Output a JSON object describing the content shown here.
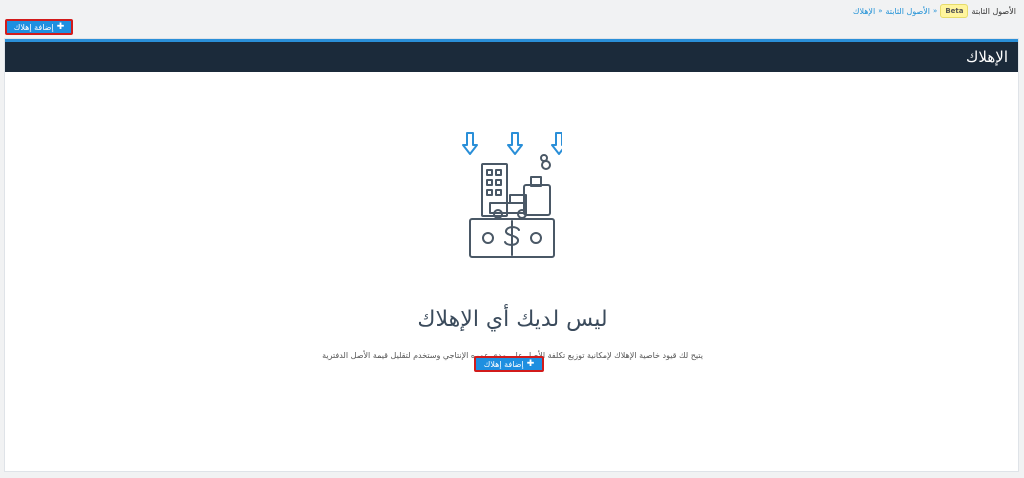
{
  "breadcrumb": {
    "root": "الأصول الثابتة",
    "badge": "Beta",
    "items": [
      "الأصول الثابتة",
      "الإهلاك"
    ]
  },
  "toolbar": {
    "add_label": "إضافة إهلاك"
  },
  "panel": {
    "title": "الإهلاك"
  },
  "empty_state": {
    "title": "ليس لديك أي الإهلاك",
    "description": "يتيح لك قيود خاصية الإهلاك لإمكانية توزيع تكلفة الأصل على مدى عمره الإنتاجي وستخدم لتقليل قيمة الأصل الدفترية",
    "button_label": "إضافة إهلاك"
  },
  "colors": {
    "header_bg": "#1b2a3a",
    "accent": "#1e8fe0",
    "button_border": "#d21b1b",
    "badge_bg": "#fff59d"
  },
  "icons": {
    "plus": "plus-icon",
    "illustration": "depreciation-illustration-icon"
  }
}
